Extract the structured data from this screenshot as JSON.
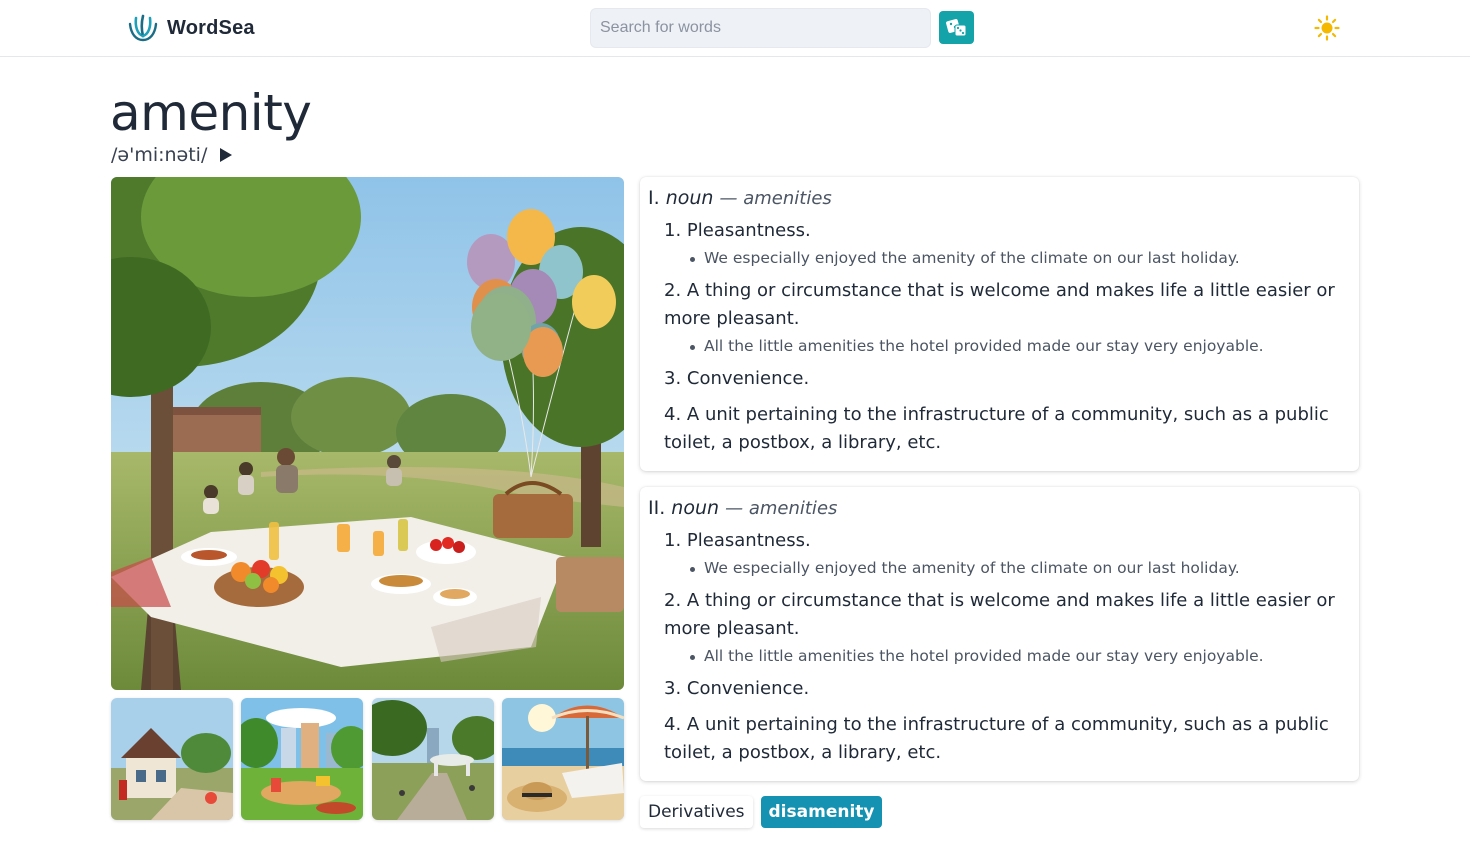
{
  "header": {
    "logo_text": "WordSea",
    "search_placeholder": "Search for words",
    "random_icon": "dice-icon",
    "theme_icon": "sun-icon",
    "accent_color": "#14a3a8",
    "sun_color": "#f5b800"
  },
  "word": {
    "title": "amenity",
    "phonetic": "/ə'mi:nəti/",
    "play_icon": "play-icon"
  },
  "images": {
    "main_alt": "Picnic in a park with balloons",
    "thumbnails": [
      "Village street scene",
      "City park playground",
      "Park with pavilion",
      "Beach with umbrella and hat"
    ]
  },
  "entries": [
    {
      "numeral": "I.",
      "pos": "noun",
      "forms": "— amenities",
      "senses": [
        {
          "num": "1.",
          "text": "Pleasantness.",
          "example": "We especially enjoyed the amenity of the climate on our last holiday."
        },
        {
          "num": "2.",
          "text": "A thing or circumstance that is welcome and makes life a little easier or more pleasant.",
          "example": "All the little amenities the hotel provided made our stay very enjoyable."
        },
        {
          "num": "3.",
          "text": "Convenience.",
          "example": ""
        },
        {
          "num": "4.",
          "text": "A unit pertaining to the infrastructure of a community, such as a public toilet, a postbox, a library, etc.",
          "example": ""
        }
      ]
    },
    {
      "numeral": "II.",
      "pos": "noun",
      "forms": "— amenities",
      "senses": [
        {
          "num": "1.",
          "text": "Pleasantness.",
          "example": "We especially enjoyed the amenity of the climate on our last holiday."
        },
        {
          "num": "2.",
          "text": "A thing or circumstance that is welcome and makes life a little easier or more pleasant.",
          "example": "All the little amenities the hotel provided made our stay very enjoyable."
        },
        {
          "num": "3.",
          "text": "Convenience.",
          "example": ""
        },
        {
          "num": "4.",
          "text": "A unit pertaining to the infrastructure of a community, such as a public toilet, a postbox, a library, etc.",
          "example": ""
        }
      ]
    }
  ],
  "derivatives": {
    "label": "Derivatives",
    "items": [
      "disamenity"
    ],
    "chip_color": "#1592b1"
  }
}
